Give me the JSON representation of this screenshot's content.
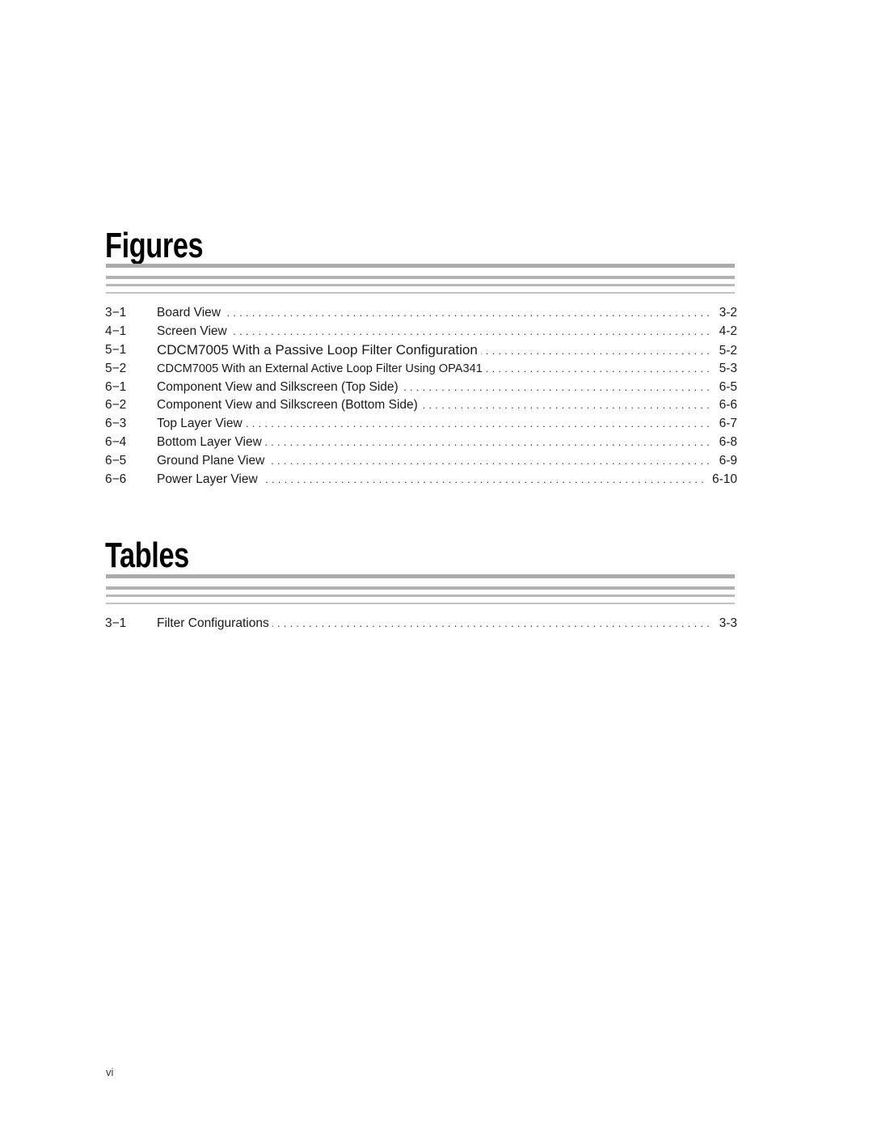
{
  "figures": {
    "heading": "Figures",
    "entries": [
      {
        "number": "3−1",
        "title": "Board View",
        "page": "3-2",
        "size": "normal"
      },
      {
        "number": "4−1",
        "title": "Screen View",
        "page": "4-2",
        "size": "normal"
      },
      {
        "number": "5−1",
        "title": "CDCM7005 With a Passive Loop Filter Configuration",
        "page": "5-2",
        "size": "large"
      },
      {
        "number": "5−2",
        "title": "CDCM7005 With an External Active Loop Filter Using OPA341",
        "page": "5-3",
        "size": "small"
      },
      {
        "number": "6−1",
        "title": "Component View and Silkscreen (Top Side)",
        "page": "6-5",
        "size": "normal"
      },
      {
        "number": "6−2",
        "title": "Component View and Silkscreen (Bottom Side)",
        "page": "6-6",
        "size": "normal"
      },
      {
        "number": "6−3",
        "title": "Top Layer View",
        "page": "6-7",
        "size": "normal"
      },
      {
        "number": "6−4",
        "title": "Bottom Layer View",
        "page": "6-8",
        "size": "normal"
      },
      {
        "number": "6−5",
        "title": "Ground Plane View",
        "page": "6-9",
        "size": "normal"
      },
      {
        "number": "6−6",
        "title": "Power Layer View",
        "page": "6-10",
        "size": "normal"
      }
    ]
  },
  "tables": {
    "heading": "Tables",
    "entries": [
      {
        "number": "3−1",
        "title": "Filter Configurations",
        "page": "3-3",
        "size": "normal"
      }
    ]
  },
  "footer": {
    "page_number": "vi"
  }
}
